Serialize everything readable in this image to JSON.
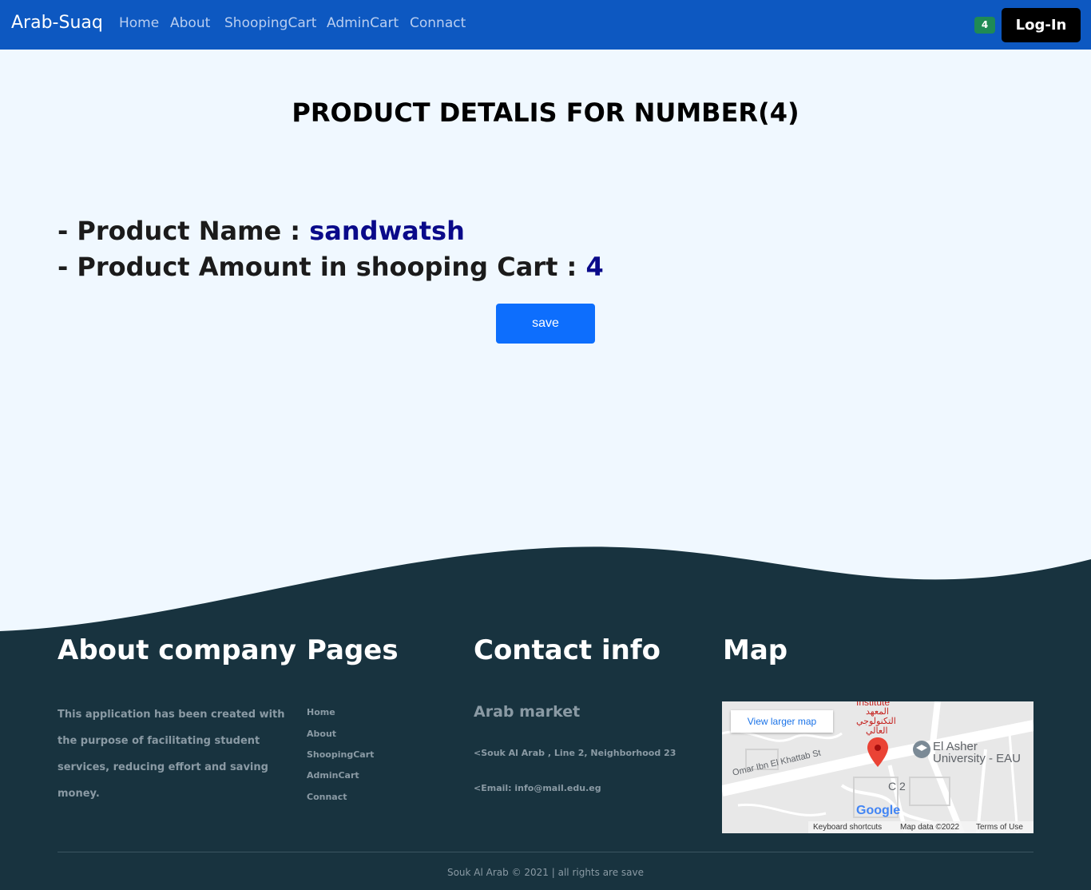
{
  "navbar": {
    "brand": "Arab-Suaq",
    "links": [
      "Home",
      "About",
      "ShoopingCart",
      "AdminCart",
      "Connact"
    ],
    "cart_count": "4",
    "login_label": "Log-In"
  },
  "main": {
    "title": "PRODUCT DETALIS FOR NUMBER(4)",
    "product_name_label": "- Product Name : ",
    "product_name_value": "sandwatsh",
    "product_amount_label": "- Product Amount in shooping Cart : ",
    "product_amount_value": "4",
    "save_label": "save"
  },
  "footer": {
    "about_heading": "About company",
    "about_text": "This application has been created with the purpose of facilitating student services, reducing effort and saving money.",
    "pages_heading": "Pages",
    "pages_links": [
      "Home",
      "About",
      "ShoopingCart",
      "AdminCart",
      "Connact"
    ],
    "contact_heading": "Contact info",
    "contact_name": "Arab market",
    "contact_address": "<Souk Al Arab , Line 2, Neighborhood 23",
    "contact_email": "<Email: info@mail.edu.eg",
    "map_heading": "Map",
    "map": {
      "larger_map_label": "View larger map",
      "place_label": "El Asher University - EAU",
      "place_label_line1": "El Asher",
      "place_label_line2": "University - EAU",
      "street_label": "Omar Ibn El Khattab St",
      "arabic_label_1": "المعهد",
      "arabic_label_2": "التكنولوجي",
      "arabic_label_3": "العالي",
      "institute_label": "Institute",
      "c2_label": "C 2",
      "keyboard_shortcuts": "Keyboard shortcuts",
      "map_data": "Map data ©2022",
      "terms": "Terms of Use",
      "google_logo": "Google"
    },
    "copyright": "Souk Al Arab © 2021 | all rights are save"
  },
  "colors": {
    "navbar": "#0d58c1",
    "page_bg": "#f0f8ff",
    "footer_bg": "#18333f",
    "save_button": "#0d6efd",
    "cart_badge": "#1f8a55",
    "value_text": "#0a0a8a"
  }
}
